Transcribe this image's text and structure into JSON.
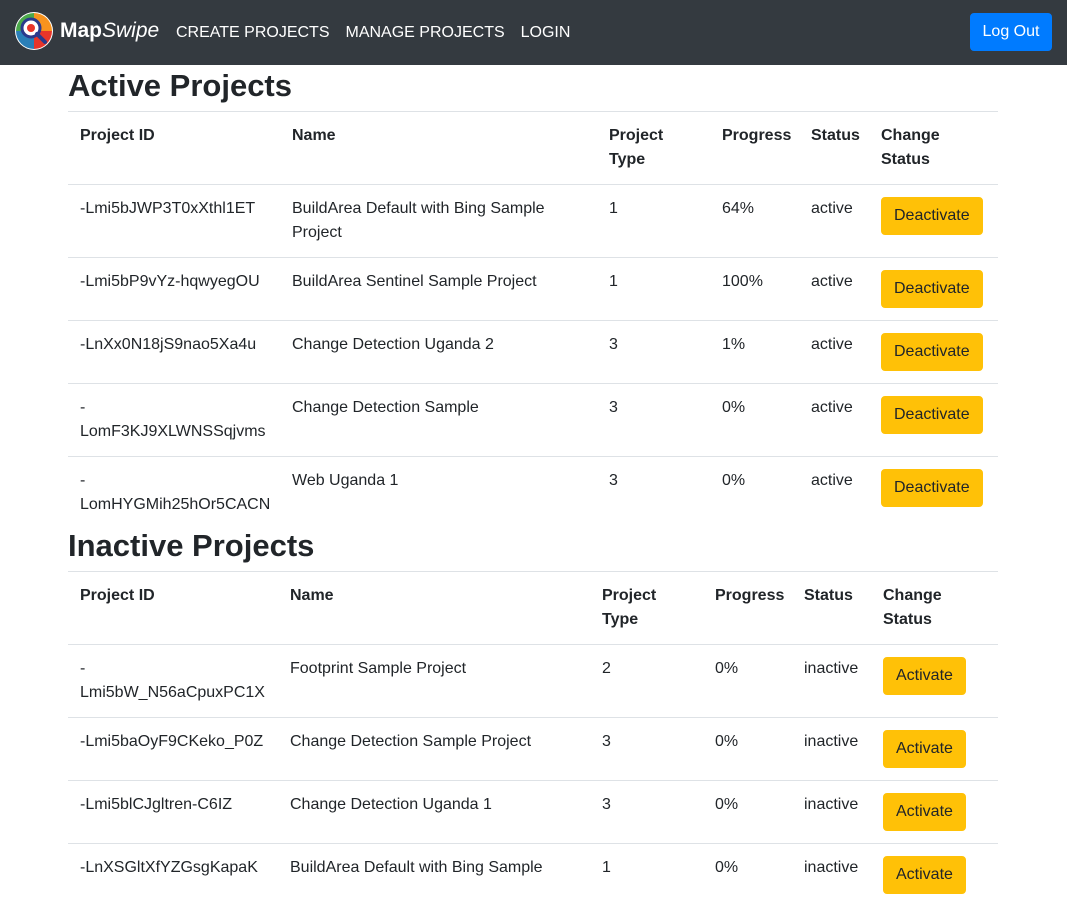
{
  "navbar": {
    "brand_part1": "Map",
    "brand_part2": "Swipe",
    "links": [
      "CREATE PROJECTS",
      "MANAGE PROJECTS",
      "LOGIN"
    ],
    "logout_label": "Log Out",
    "logout_color": "#007bff"
  },
  "active": {
    "title": "Active Projects",
    "headers": [
      "Project ID",
      "Name",
      "Project Type",
      "Progress",
      "Status",
      "Change Status"
    ],
    "rows": [
      {
        "id": "-Lmi5bJWP3T0xXthl1ET",
        "name": "BuildArea Default with Bing Sample Project",
        "type": "1",
        "progress": "64%",
        "status": "active",
        "action": "Deactivate"
      },
      {
        "id": "-Lmi5bP9vYz-hqwyegOU",
        "name": "BuildArea Sentinel Sample Project",
        "type": "1",
        "progress": "100%",
        "status": "active",
        "action": "Deactivate"
      },
      {
        "id": "-LnXx0N18jS9nao5Xa4u",
        "name": "Change Detection Uganda 2",
        "type": "3",
        "progress": "1%",
        "status": "active",
        "action": "Deactivate"
      },
      {
        "id": "-LomF3KJ9XLWNSSqjvms",
        "name": "Change Detection Sample",
        "type": "3",
        "progress": "0%",
        "status": "active",
        "action": "Deactivate"
      },
      {
        "id": "-LomHYGMih25hOr5CACN",
        "name": "Web Uganda 1",
        "type": "3",
        "progress": "0%",
        "status": "active",
        "action": "Deactivate"
      }
    ]
  },
  "inactive": {
    "title": "Inactive Projects",
    "headers": [
      "Project ID",
      "Name",
      "Project Type",
      "Progress",
      "Status",
      "Change Status"
    ],
    "rows": [
      {
        "id": "-Lmi5bW_N56aCpuxPC1X",
        "name": "Footprint Sample Project",
        "type": "2",
        "progress": "0%",
        "status": "inactive",
        "action": "Activate"
      },
      {
        "id": "-Lmi5baOyF9CKeko_P0Z",
        "name": "Change Detection Sample Project",
        "type": "3",
        "progress": "0%",
        "status": "inactive",
        "action": "Activate"
      },
      {
        "id": "-Lmi5blCJgltren-C6IZ",
        "name": "Change Detection Uganda 1",
        "type": "3",
        "progress": "0%",
        "status": "inactive",
        "action": "Activate"
      },
      {
        "id": "-LnXSGltXfYZGsgKapaK",
        "name": "BuildArea Default with Bing Sample",
        "type": "1",
        "progress": "0%",
        "status": "inactive",
        "action": "Activate"
      }
    ]
  },
  "colors": {
    "navbar_bg": "#343a40",
    "button_warning": "#ffc107",
    "row_border": "#dee2e6"
  }
}
